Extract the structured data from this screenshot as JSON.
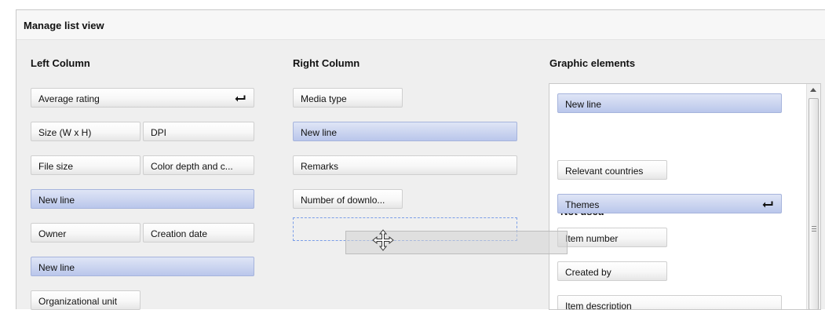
{
  "panel": {
    "title": "Manage list view"
  },
  "columns": {
    "left": {
      "heading": "Left Column",
      "items": [
        {
          "label": "Average rating"
        },
        {
          "label": "Size (W x H)"
        },
        {
          "label": "DPI"
        },
        {
          "label": "File size"
        },
        {
          "label": "Color depth and c..."
        },
        {
          "label": "New line"
        },
        {
          "label": "Owner"
        },
        {
          "label": "Creation date"
        },
        {
          "label": "New line"
        },
        {
          "label": "Organizational unit"
        }
      ]
    },
    "right": {
      "heading": "Right Column",
      "items": [
        {
          "label": "Media type"
        },
        {
          "label": "New line"
        },
        {
          "label": "Remarks"
        },
        {
          "label": "Number of downlo..."
        }
      ]
    },
    "graphic": {
      "heading": "Graphic elements",
      "new_line_label": "New line",
      "not_used_heading": "Not used",
      "items": [
        {
          "label": "Relevant countries"
        },
        {
          "label": "Themes"
        },
        {
          "label": "Item number"
        },
        {
          "label": "Created by"
        },
        {
          "label": "Item description"
        }
      ]
    }
  },
  "icons": {
    "line_break": "return-arrow-icon",
    "drag_cursor": "move-cursor-icon",
    "scroll_up": "scroll-up-arrow-icon"
  },
  "colors": {
    "new_line_fill": "#c9d3ef",
    "new_line_border": "#a6b4dc",
    "drop_zone_border": "#7a9ee8",
    "panel_bg": "#efefef"
  }
}
